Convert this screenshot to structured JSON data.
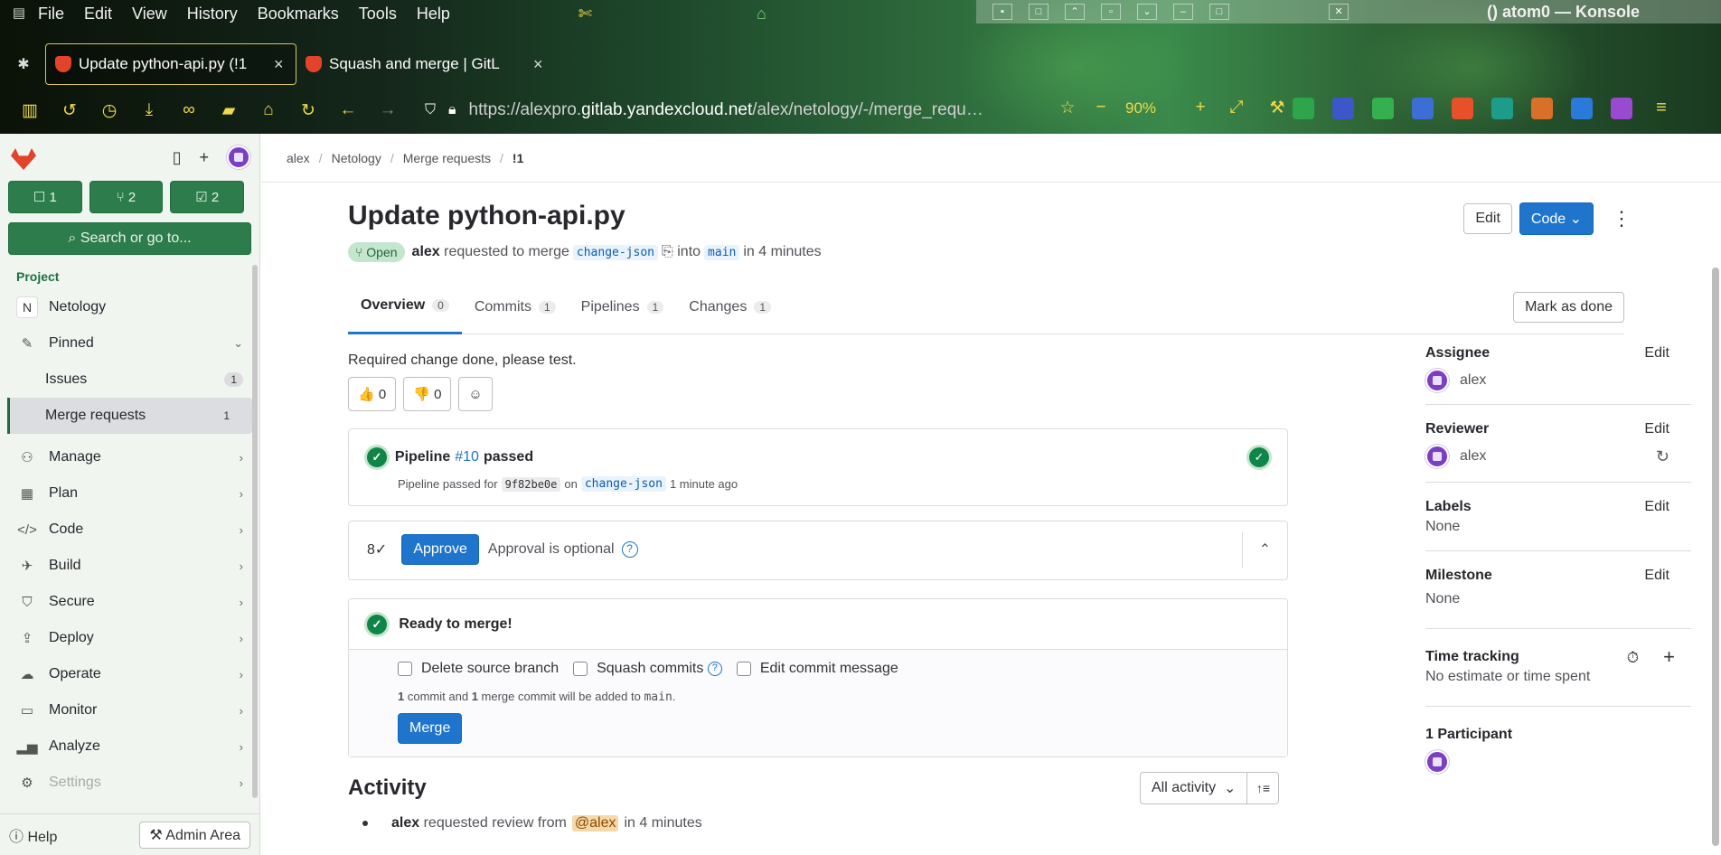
{
  "browser": {
    "menus": [
      "File",
      "Edit",
      "View",
      "History",
      "Bookmarks",
      "Tools",
      "Help"
    ],
    "konsole_title": "() atom0 — Konsole",
    "tabs": [
      {
        "title": "Update python-api.py (!1",
        "active": true
      },
      {
        "title": "Squash and merge | GitL",
        "active": false
      }
    ],
    "url_prefix": "https://alexpro.",
    "url_host": "gitlab.yandexcloud.net",
    "url_path": "/alex/netology/-/merge_requ…",
    "zoom": "90%"
  },
  "sidebar": {
    "counts": [
      {
        "icon": "issues-icon",
        "value": "1"
      },
      {
        "icon": "merge-request-icon",
        "value": "2"
      },
      {
        "icon": "todo-icon",
        "value": "2"
      }
    ],
    "search_label": "Search or go to...",
    "section_label": "Project",
    "project_initial": "N",
    "project_name": "Netology",
    "pinned_label": "Pinned",
    "pinned_items": [
      {
        "label": "Issues",
        "count": "1",
        "active": false
      },
      {
        "label": "Merge requests",
        "count": "1",
        "active": true
      }
    ],
    "groups": [
      "Manage",
      "Plan",
      "Code",
      "Build",
      "Secure",
      "Deploy",
      "Operate",
      "Monitor",
      "Analyze",
      "Settings"
    ],
    "help_label": "Help",
    "admin_label": "Admin Area"
  },
  "breadcrumb": [
    "alex",
    "Netology",
    "Merge requests",
    "!1"
  ],
  "mr": {
    "title": "Update python-api.py",
    "status": "Open",
    "author": "alex",
    "requested_text": "requested to merge",
    "source_branch": "change-json",
    "into_text": "into",
    "target_branch": "main",
    "time_text": "in 4 minutes",
    "edit_label": "Edit",
    "code_label": "Code",
    "tabs": [
      {
        "label": "Overview",
        "count": "0"
      },
      {
        "label": "Commits",
        "count": "1"
      },
      {
        "label": "Pipelines",
        "count": "1"
      },
      {
        "label": "Changes",
        "count": "1"
      }
    ],
    "mark_done_label": "Mark as done",
    "description": "Required change done, please test.",
    "thumbs_up": "0",
    "thumbs_down": "0"
  },
  "pipeline": {
    "prefix": "Pipeline",
    "link": "#10",
    "status": "passed",
    "detail_prefix": "Pipeline passed for",
    "sha": "9f82be0e",
    "on": "on",
    "branch": "change-json",
    "time": "1 minute ago"
  },
  "approval": {
    "button": "Approve",
    "text": "Approval is optional"
  },
  "merge_box": {
    "title": "Ready to merge!",
    "options": [
      "Delete source branch",
      "Squash commits",
      "Edit commit message"
    ],
    "info_count1": "1",
    "info_mid": "commit and",
    "info_count2": "1",
    "info_end": "merge commit will be added to",
    "info_branch": "main",
    "button": "Merge"
  },
  "activity": {
    "title": "Activity",
    "filter": "All activity",
    "line_author": "alex",
    "line_text": "requested review from",
    "line_mention": "@alex",
    "line_time": "in 4 minutes"
  },
  "right_panel": {
    "assignee_label": "Assignee",
    "assignee": "alex",
    "reviewer_label": "Reviewer",
    "reviewer": "alex",
    "labels_label": "Labels",
    "labels_value": "None",
    "milestone_label": "Milestone",
    "milestone_value": "None",
    "time_label": "Time tracking",
    "time_value": "No estimate or time spent",
    "participants_label": "1 Participant",
    "edit": "Edit"
  }
}
